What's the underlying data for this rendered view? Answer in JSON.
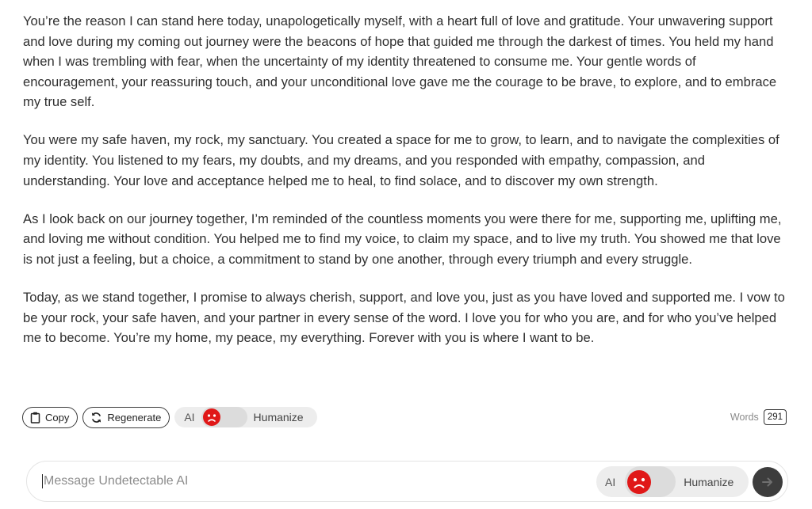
{
  "message": {
    "paragraphs": [
      "You’re the reason I can stand here today, unapologetically myself, with a heart full of love and gratitude. Your unwavering support and love during my coming out journey were the beacons of hope that guided me through the darkest of times. You held my hand when I was trembling with fear, when the uncertainty of my identity threatened to consume me. Your gentle words of encouragement, your reassuring touch, and your unconditional love gave me the courage to be brave, to explore, and to embrace my true self.",
      "You were my safe haven, my rock, my sanctuary. You created a space for me to grow, to learn, and to navigate the complexities of my identity. You listened to my fears, my doubts, and my dreams, and you responded with empathy, compassion, and understanding. Your love and acceptance helped me to heal, to find solace, and to discover my own strength.",
      "As I look back on our journey together, I’m reminded of the countless moments you were there for me, supporting me, uplifting me, and loving me without condition. You helped me to find my voice, to claim my space, and to live my truth. You showed me that love is not just a feeling, but a choice, a commitment to stand by one another, through every triumph and every struggle.",
      "Today, as we stand together, I promise to always cherish, support, and love you, just as you have loved and supported me. I vow to be your rock, your safe haven, and your partner in every sense of the word. I love you for who you are, and for who you’ve helped me to become. You’re my home, my peace, my everything. Forever with you is where I want to be."
    ]
  },
  "actions": {
    "copy_label": "Copy",
    "copy_icon": "clipboard-icon",
    "regenerate_label": "Regenerate",
    "regenerate_icon": "refresh-icon",
    "toggle_ai_label": "AI",
    "toggle_humanize_label": "Humanize",
    "toggle_icon": "sad-face-icon",
    "words_label": "Words",
    "words_count": "291"
  },
  "composer": {
    "placeholder": "Message Undetectable AI",
    "value": "",
    "toggle_ai_label": "AI",
    "toggle_humanize_label": "Humanize",
    "send_icon": "arrow-right-icon"
  },
  "colors": {
    "toggle_face": "#e01818",
    "send_button": "#3d3d3d",
    "toggle_track": "#ededed"
  }
}
